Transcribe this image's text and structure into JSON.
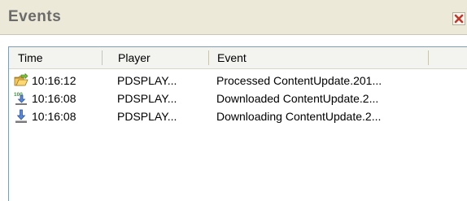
{
  "panel": {
    "title": "Events",
    "close_icon": "close-icon"
  },
  "columns": [
    "Time",
    "Player",
    "Event"
  ],
  "rows": [
    {
      "icon": "folder-open-icon",
      "time": "10:16:12",
      "player": "PDSPLAY...",
      "event": "Processed ContentUpdate.201..."
    },
    {
      "icon": "download-complete-icon",
      "badge": "100",
      "time": "10:16:08",
      "player": "PDSPLAY...",
      "event": "Downloaded ContentUpdate.2..."
    },
    {
      "icon": "download-icon",
      "time": "10:16:08",
      "player": "PDSPLAY...",
      "event": "Downloading ContentUpdate.2..."
    }
  ],
  "colors": {
    "titlebar": "#ece9d8",
    "title_text": "#6b6b6b",
    "close_x": "#c0392b",
    "grid_border": "#7f9db9"
  }
}
